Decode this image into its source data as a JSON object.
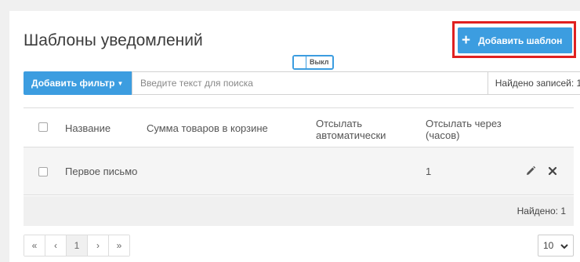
{
  "page": {
    "title": "Шаблоны уведомлений"
  },
  "header": {
    "add_label": "Добавить шаблон"
  },
  "filter": {
    "add_filter_label": "Добавить фильтр",
    "search_placeholder": "Введите текст для поиска",
    "records_found": "Найдено записей: 1"
  },
  "table": {
    "columns": [
      "Название",
      "Сумма товаров в корзине",
      "Отсылать автоматически",
      "Отсылать через (часов)"
    ],
    "rows": [
      {
        "name": "Первое письмо",
        "cart_sum": "",
        "auto_send": "Выкл",
        "send_after_hours": "1"
      }
    ],
    "footer_count": "Найдено: 1"
  },
  "pagination": {
    "first": "«",
    "prev": "‹",
    "current": "1",
    "next": "›",
    "last": "»",
    "page_size": "10"
  },
  "colors": {
    "accent": "#3c9de0",
    "highlight": "#e02020"
  },
  "icons": [
    "plus-icon",
    "caret-down-icon",
    "edit-pencil-icon",
    "delete-x-icon",
    "chevron-down-icon"
  ]
}
